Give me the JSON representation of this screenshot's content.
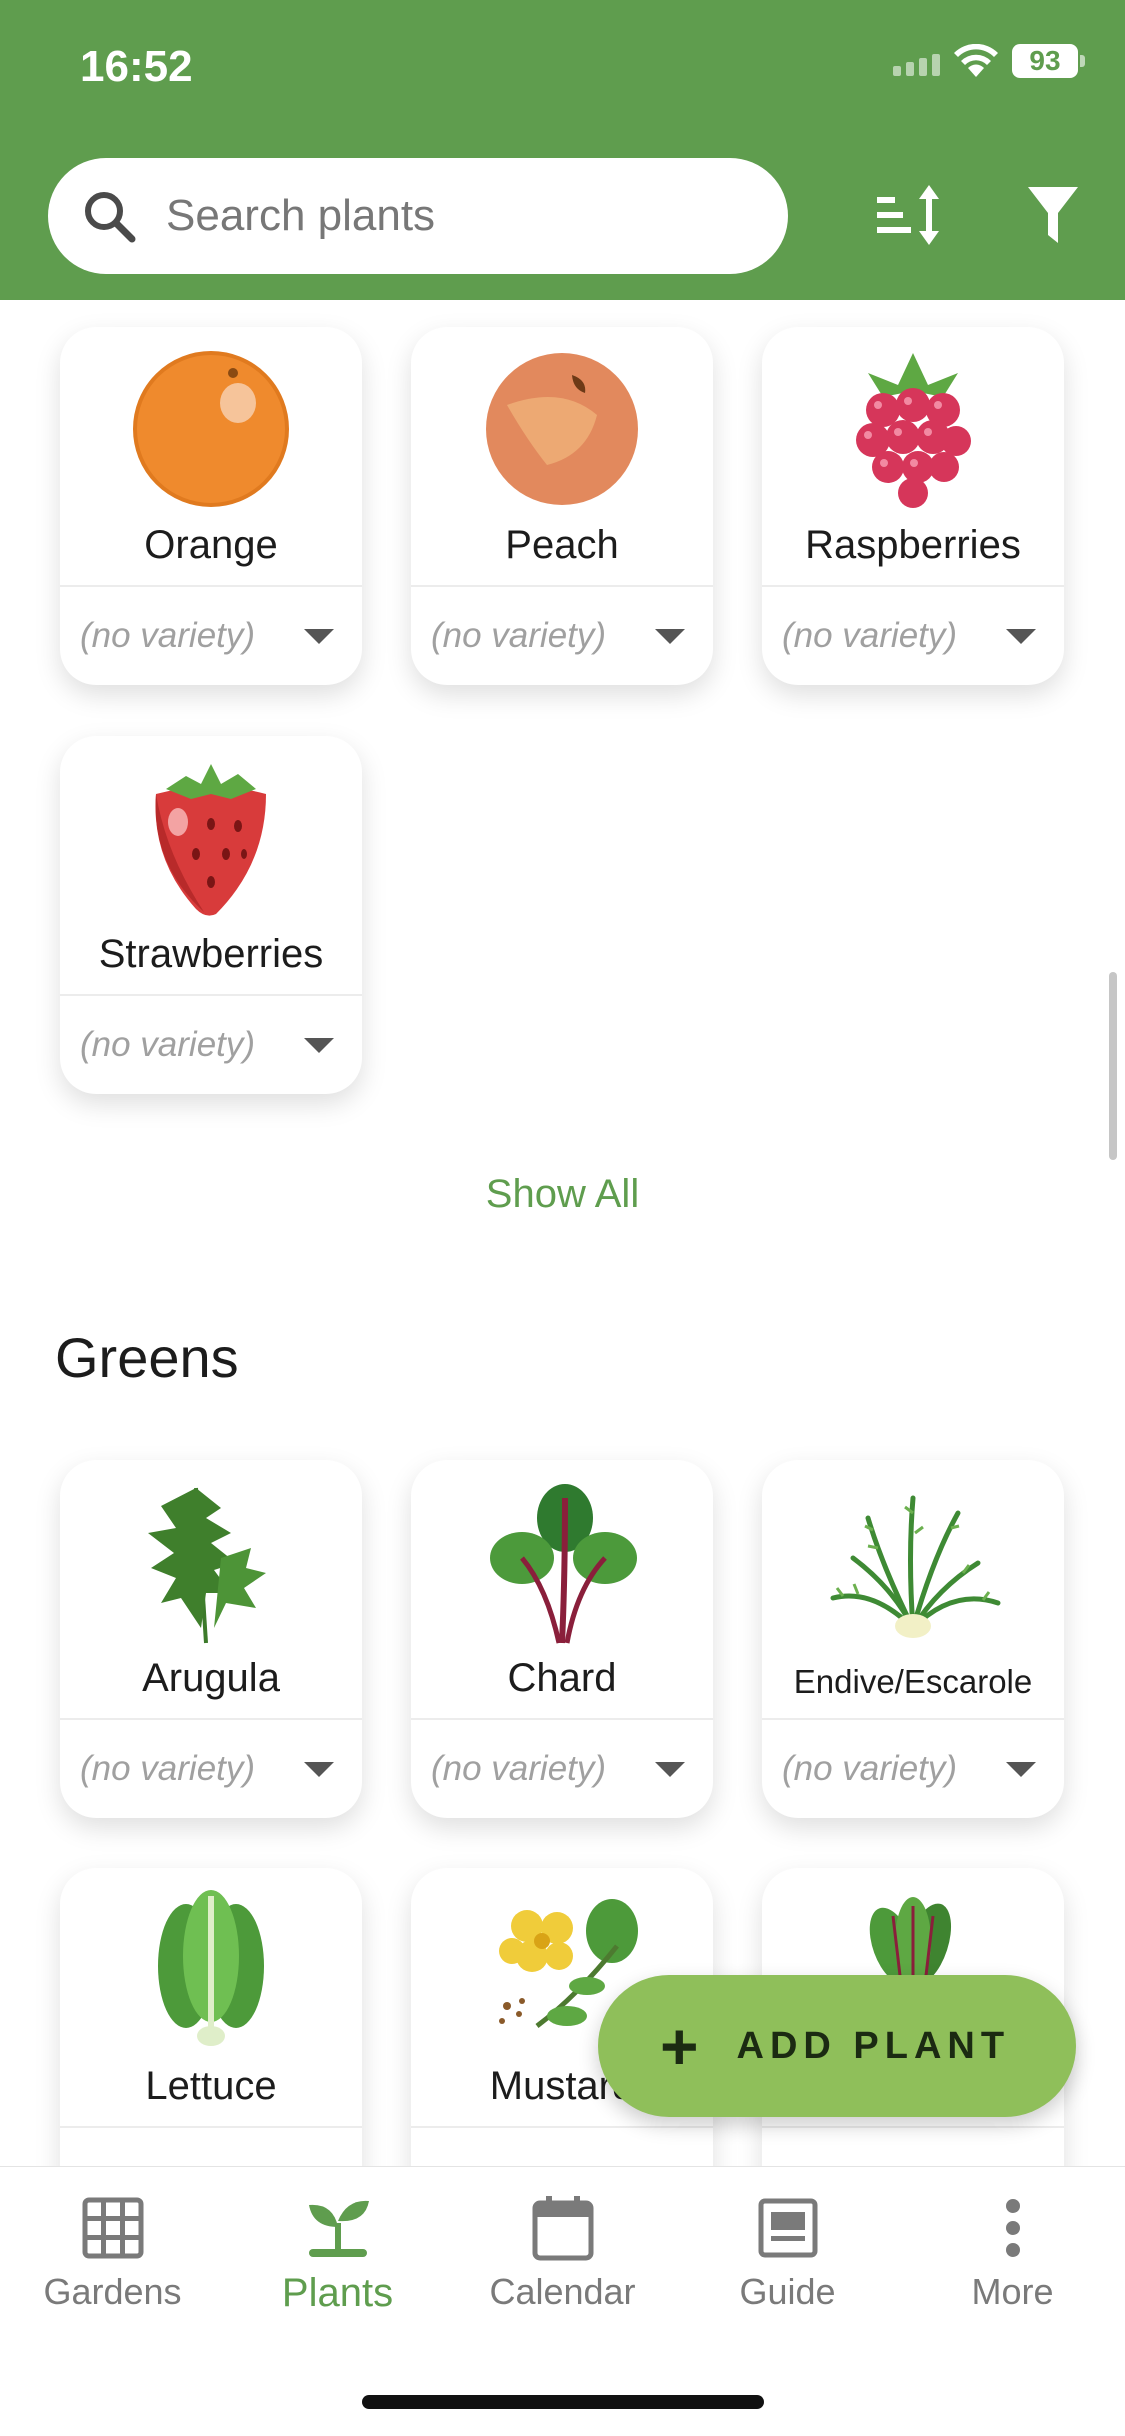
{
  "status_bar": {
    "time": "16:52",
    "battery": "93"
  },
  "search": {
    "placeholder": "Search plants"
  },
  "fruits_cards": [
    {
      "name": "Orange",
      "variety": "(no variety)",
      "icon": "orange-icon"
    },
    {
      "name": "Peach",
      "variety": "(no variety)",
      "icon": "peach-icon"
    },
    {
      "name": "Raspberries",
      "variety": "(no variety)",
      "icon": "raspberry-icon"
    },
    {
      "name": "Strawberries",
      "variety": "(no variety)",
      "icon": "strawberry-icon"
    }
  ],
  "show_all_label": "Show All",
  "greens": {
    "title": "Greens",
    "cards": [
      {
        "name": "Arugula",
        "variety": "(no variety)",
        "icon": "arugula-icon"
      },
      {
        "name": "Chard",
        "variety": "(no variety)",
        "icon": "chard-icon"
      },
      {
        "name": "Endive/Escarole",
        "variety": "(no variety)",
        "icon": "endive-icon"
      },
      {
        "name": "Lettuce",
        "icon": "lettuce-icon"
      },
      {
        "name": "Mustard",
        "icon": "mustard-icon"
      },
      {
        "name": "",
        "icon": "greens-icon"
      }
    ]
  },
  "fab": {
    "label": "ADD PLANT"
  },
  "nav": [
    {
      "label": "Gardens",
      "icon": "grid-icon"
    },
    {
      "label": "Plants",
      "icon": "sprout-icon",
      "active": true
    },
    {
      "label": "Calendar",
      "icon": "calendar-icon"
    },
    {
      "label": "Guide",
      "icon": "guide-icon"
    },
    {
      "label": "More",
      "icon": "more-icon"
    }
  ],
  "colors": {
    "header": "#5f9d4e",
    "fab": "#8fbf5a",
    "accent": "#5f9d4e"
  }
}
